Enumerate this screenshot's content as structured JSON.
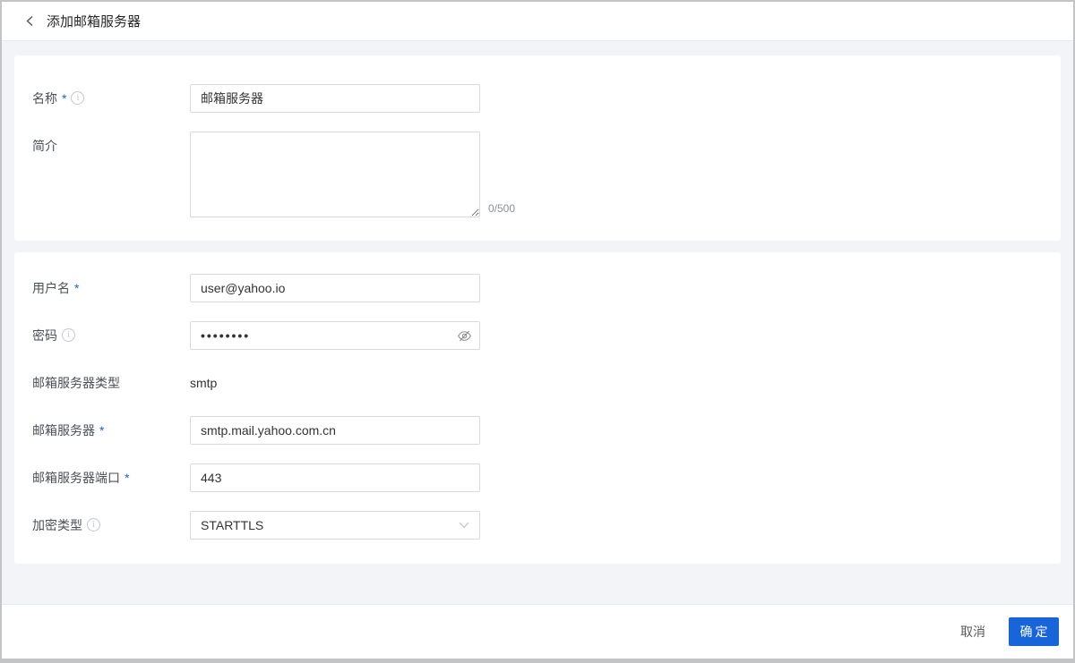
{
  "header": {
    "title": "添加邮箱服务器",
    "back_icon": "chevron-left-icon"
  },
  "required_mark": "*",
  "icons": {
    "info_glyph": "i"
  },
  "form": {
    "basic": {
      "name": {
        "label": "名称",
        "value": "邮箱服务器",
        "required": true,
        "has_info": true
      },
      "description": {
        "label": "简介",
        "value": "",
        "counter": "0/500",
        "max_length": 500
      }
    },
    "server": {
      "username": {
        "label": "用户名",
        "value": "user@yahoo.io",
        "required": true
      },
      "password": {
        "label": "密码",
        "value": "••••••••",
        "has_info": true,
        "masked": true
      },
      "server_type": {
        "label": "邮箱服务器类型",
        "value": "smtp"
      },
      "server_host": {
        "label": "邮箱服务器",
        "value": "smtp.mail.yahoo.com.cn",
        "required": true
      },
      "server_port": {
        "label": "邮箱服务器端口",
        "value": "443",
        "required": true
      },
      "encryption": {
        "label": "加密类型",
        "value": "STARTTLS",
        "has_info": true
      }
    }
  },
  "footer": {
    "cancel_label": "取消",
    "confirm_label": "确定"
  },
  "colors": {
    "accent": "#1765d8",
    "page_background": "#f3f4f8",
    "card_background": "#ffffff",
    "input_border": "#d9d9d9",
    "label_text": "#4b4f56",
    "muted_icon": "#c4c7cf"
  }
}
